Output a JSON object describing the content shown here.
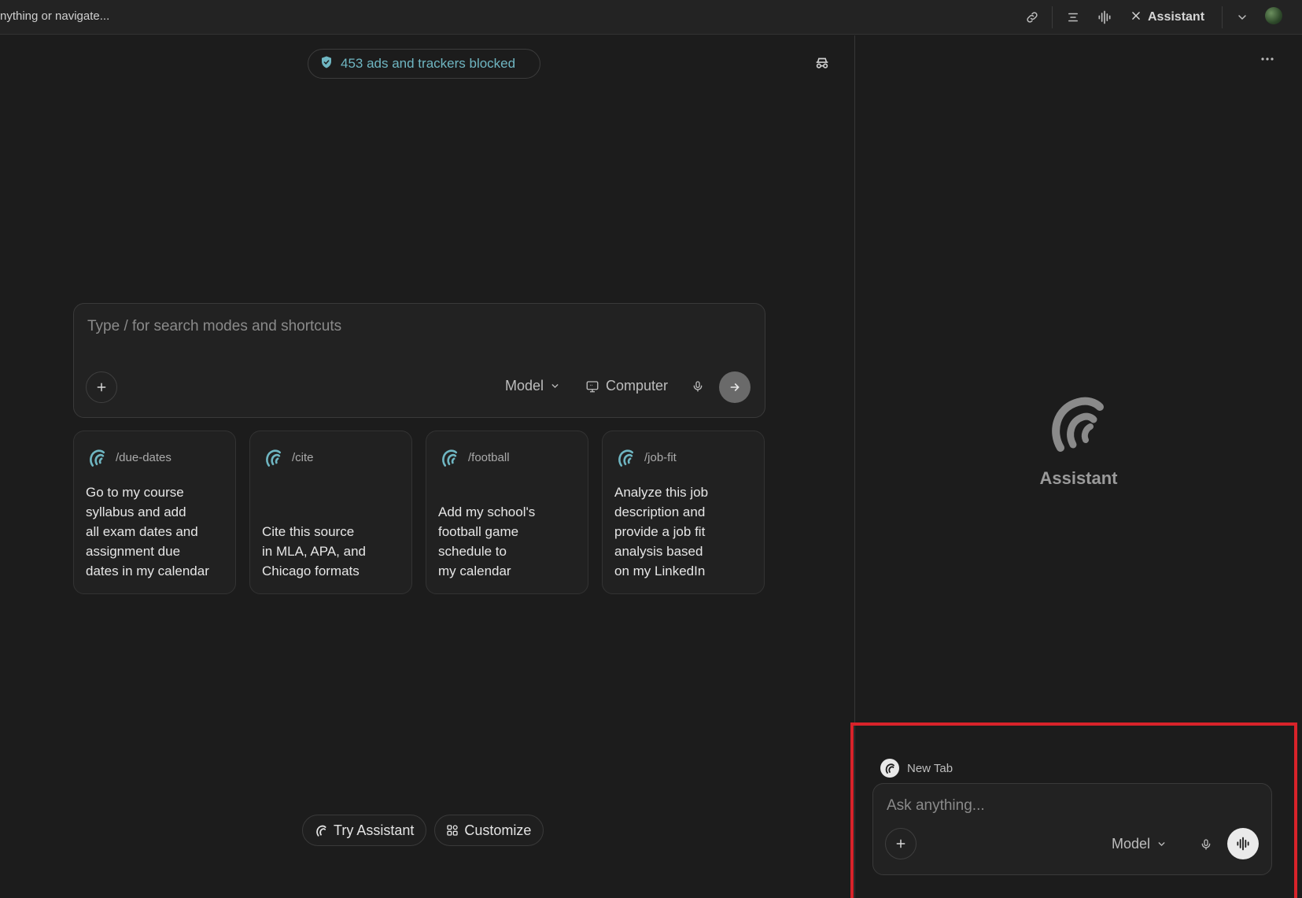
{
  "topbar": {
    "url_text": "nything or navigate...",
    "assistant_label": "Assistant",
    "icons": [
      "link-icon",
      "reader-icon",
      "voice-icon",
      "close-icon",
      "chevron-down-icon",
      "profile-avatar"
    ]
  },
  "main": {
    "tracker_text": "453 ads and trackers blocked",
    "search": {
      "placeholder": "Type / for search modes and shortcuts",
      "model_label": "Model",
      "computer_label": "Computer"
    },
    "shortcuts": [
      {
        "command": "/due-dates",
        "body": "Go to my course\nsyllabus and add\nall exam dates and\nassignment due\ndates in my calendar"
      },
      {
        "command": "/cite",
        "body": "Cite this source\nin MLA, APA, and\nChicago formats"
      },
      {
        "command": "/football",
        "body": "Add my school's\nfootball game\nschedule to\nmy calendar"
      },
      {
        "command": "/job-fit",
        "body": "Analyze this job\ndescription and\nprovide a job fit\nanalysis based\non my LinkedIn"
      }
    ],
    "try_assistant_label": "Try Assistant",
    "customize_label": "Customize"
  },
  "assistant_panel": {
    "title": "Assistant",
    "context_tab": "New Tab",
    "composer": {
      "placeholder": "Ask anything...",
      "model_label": "Model"
    }
  },
  "colors": {
    "background": "#1c1c1c",
    "accent_teal": "#6fb6c2",
    "highlight_box": "#d8232a"
  }
}
